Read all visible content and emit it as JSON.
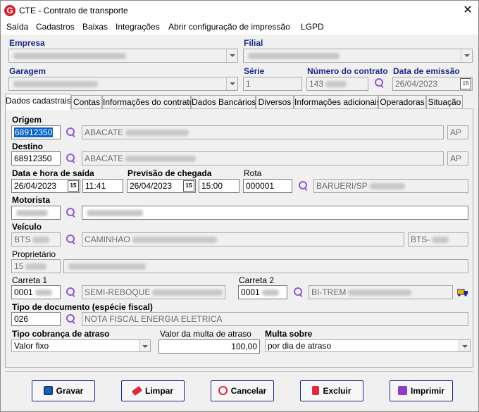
{
  "window": {
    "title": "CTE - Contrato de transporte",
    "logo_letter": "G",
    "close_glyph": "✕"
  },
  "menu": [
    "Saída",
    "Cadastros",
    "Baixas",
    "Integrações",
    "Abrir configuração de impressão",
    "LGPD"
  ],
  "header": {
    "empresa_label": "Empresa",
    "filial_label": "Filial",
    "garagem_label": "Garagem",
    "serie_label": "Série",
    "serie_value": "1",
    "numero_label": "Número do contrato",
    "numero_value": "143",
    "data_emissao_label": "Data de emissão",
    "data_emissao_value": "26/04/2023"
  },
  "tabs": [
    "Dados cadastrais",
    "Contas",
    "Informações do contrato",
    "Dados Bancários",
    "Diversos",
    "Informações adicionais",
    "Operadoras",
    "Situação"
  ],
  "form": {
    "origem_label": "Origem",
    "origem_code": "68912350",
    "origem_city": "ABACATE",
    "origem_uf": "AP",
    "destino_label": "Destino",
    "destino_code": "68912350",
    "destino_city": "ABACATE",
    "destino_uf": "AP",
    "saida_label": "Data e hora de saída",
    "saida_date": "26/04/2023",
    "saida_time": "11:41",
    "chegada_label": "Previsão de chegada",
    "chegada_date": "26/04/2023",
    "chegada_time": "15:00",
    "rota_label": "Rota",
    "rota_code": "000001",
    "rota_desc": "BARUERI/SP",
    "motorista_label": "Motorista",
    "veiculo_label": "Veículo",
    "veiculo_code": "BTS",
    "veiculo_desc": "CAMINHAO",
    "veiculo_plate": "BTS-",
    "proprietario_label": "Proprietário",
    "proprietario_code": "15",
    "carreta1_label": "Carreta 1",
    "carreta1_code": "0001",
    "carreta1_desc": "SEMI-REBOQUE",
    "carreta2_label": "Carreta 2",
    "carreta2_code": "0001",
    "carreta2_desc": "BI-TREM",
    "tipo_doc_label": "Tipo de documento (espécie fiscal)",
    "tipo_doc_code": "026",
    "tipo_doc_desc": "NOTA FISCAL ENERGIA ELETRICA",
    "cobranca_label": "Tipo cobrança de atraso",
    "cobranca_value": "Valor fixo",
    "multa_valor_label": "Valor da multa de atraso",
    "multa_valor_value": "100,00",
    "multa_sobre_label": "Multa sobre",
    "multa_sobre_value": "por dia de atraso",
    "calendar_glyph": "15"
  },
  "buttons": {
    "gravar": "Gravar",
    "limpar": "Limpar",
    "cancelar": "Cancelar",
    "excluir": "Excluir",
    "imprimir": "Imprimir"
  },
  "colors": {
    "label_blue": "#1a2a8c",
    "selection": "#0a64c8",
    "search_icon": "#8e5bd1",
    "logo_red": "#d3212f"
  }
}
